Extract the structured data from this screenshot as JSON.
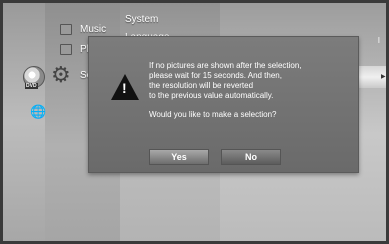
{
  "menu": {
    "items": [
      {
        "label": "Music",
        "icon": "music-icon"
      },
      {
        "label": "Photo",
        "icon": "photo-icon"
      },
      {
        "label": "Setup",
        "icon": "gear-icon"
      }
    ],
    "disc_label": "DVD"
  },
  "settings": {
    "items": [
      "System",
      "Language"
    ],
    "value_fragment": "l"
  },
  "dialog": {
    "lines": [
      "If no pictures are shown after the selection,",
      "please wait for 15 seconds. And then,",
      "the resolution will be reverted",
      "to the previous value automatically.",
      "Would you like to make a selection?"
    ],
    "yes_label": "Yes",
    "no_label": "No",
    "icon": "warning-icon"
  }
}
